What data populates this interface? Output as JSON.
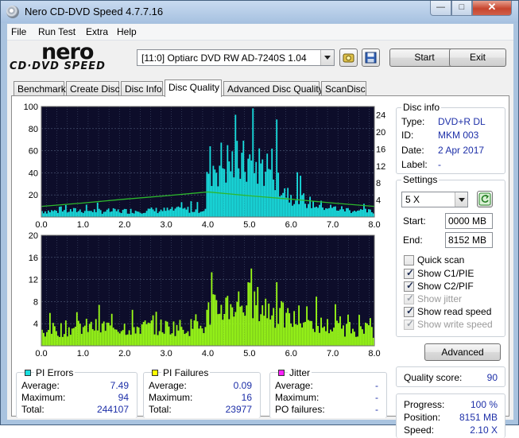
{
  "window": {
    "title": "Nero CD-DVD Speed 4.7.7.16"
  },
  "menu": [
    "File",
    "Run Test",
    "Extra",
    "Help"
  ],
  "logo": {
    "brand": "nero",
    "product": "CD·DVD SPEED"
  },
  "toolbar": {
    "drive": "[11:0]  Optiarc DVD RW AD-7240S 1.04",
    "start_label": "Start",
    "exit_label": "Exit"
  },
  "tabs": [
    "Benchmark",
    "Create Disc",
    "Disc Info",
    "Disc Quality",
    "Advanced Disc Quality",
    "ScanDisc"
  ],
  "active_tab": "Disc Quality",
  "disc_info": {
    "title": "Disc info",
    "type_label": "Type:",
    "type": "DVD+R DL",
    "id_label": "ID:",
    "id": "MKM 003",
    "date_label": "Date:",
    "date": "2 Apr 2017",
    "label_label": "Label:",
    "label": "-"
  },
  "settings": {
    "title": "Settings",
    "speed": "5 X",
    "start_label": "Start:",
    "start": "0000 MB",
    "end_label": "End:",
    "end": "8152 MB",
    "quick_scan": "Quick scan",
    "show_c1": "Show C1/PIE",
    "show_c2": "Show C2/PIF",
    "show_jitter": "Show jitter",
    "show_read": "Show read speed",
    "show_write": "Show write speed",
    "advanced_label": "Advanced"
  },
  "quality": {
    "label": "Quality score:",
    "value": "90"
  },
  "progress": {
    "progress_label": "Progress:",
    "progress": "100 %",
    "position_label": "Position:",
    "position": "8151 MB",
    "speed_label": "Speed:",
    "speed": "2.10 X"
  },
  "pi_errors": {
    "title": "PI Errors",
    "avg_label": "Average:",
    "avg": "7.49",
    "max_label": "Maximum:",
    "max": "94",
    "total_label": "Total:",
    "total": "244107"
  },
  "pi_failures": {
    "title": "PI Failures",
    "avg_label": "Average:",
    "avg": "0.09",
    "max_label": "Maximum:",
    "max": "16",
    "total_label": "Total:",
    "total": "23977"
  },
  "jitter": {
    "title": "Jitter",
    "avg_label": "Average:",
    "avg": "-",
    "max_label": "Maximum:",
    "max": "-",
    "po_label": "PO failures:",
    "po": "-"
  },
  "colors": {
    "plot_bg": "#0d0d2a",
    "pie": "#19e0e0",
    "pif": "#9cff17",
    "speed_line": "#2db82d",
    "grid": "#4f5d7a",
    "pi_errors_legend": "#19e0e0",
    "pi_failures_legend": "#ffff00",
    "jitter_legend": "#ff20ff"
  },
  "chart_data": [
    {
      "type": "bar",
      "name": "PI Errors",
      "x_ticks": [
        "0.0",
        "1.0",
        "2.0",
        "3.0",
        "4.0",
        "5.0",
        "6.0",
        "7.0",
        "8.0"
      ],
      "y_ticks": [
        "100",
        "80",
        "60",
        "40",
        "20"
      ],
      "y2_ticks": [
        "24",
        "20",
        "16",
        "12",
        "8",
        "4"
      ],
      "xlim": [
        0,
        8
      ],
      "ylim": [
        0,
        100
      ],
      "y2lim": [
        0,
        26
      ],
      "series": [
        {
          "kind": "envelope",
          "x": [
            0,
            0.5,
            1.0,
            1.5,
            2.0,
            2.5,
            3.0,
            3.5,
            3.95,
            4.0,
            4.3,
            4.6,
            5.0,
            5.3,
            5.6,
            5.8,
            6.0,
            6.5,
            7.0,
            7.5,
            8.0
          ],
          "values": [
            8,
            8,
            9,
            8,
            8,
            9,
            9,
            10,
            10,
            68,
            72,
            72,
            70,
            70,
            66,
            40,
            30,
            18,
            12,
            9,
            7
          ]
        },
        {
          "kind": "line",
          "x": [
            0,
            1.0,
            2.0,
            3.0,
            4.0,
            5.0,
            6.0,
            7.0,
            8.0
          ],
          "values": [
            2.5,
            3.3,
            4.2,
            5.0,
            5.9,
            5.0,
            4.2,
            3.3,
            2.5
          ]
        }
      ]
    },
    {
      "type": "bar",
      "name": "PI Failures",
      "x_ticks": [
        "0.0",
        "1.0",
        "2.0",
        "3.0",
        "4.0",
        "5.0",
        "6.0",
        "7.0",
        "8.0"
      ],
      "y_ticks": [
        "20",
        "16",
        "12",
        "8",
        "4"
      ],
      "xlim": [
        0,
        8
      ],
      "ylim": [
        0,
        20
      ],
      "series": [
        {
          "kind": "envelope",
          "x": [
            0,
            1.0,
            2.0,
            3.0,
            3.95,
            4.0,
            4.5,
            5.0,
            5.4,
            6.0,
            7.0,
            8.0
          ],
          "values": [
            4,
            5,
            5,
            5,
            5,
            9,
            11,
            12,
            10,
            7,
            5,
            4
          ]
        }
      ]
    }
  ]
}
